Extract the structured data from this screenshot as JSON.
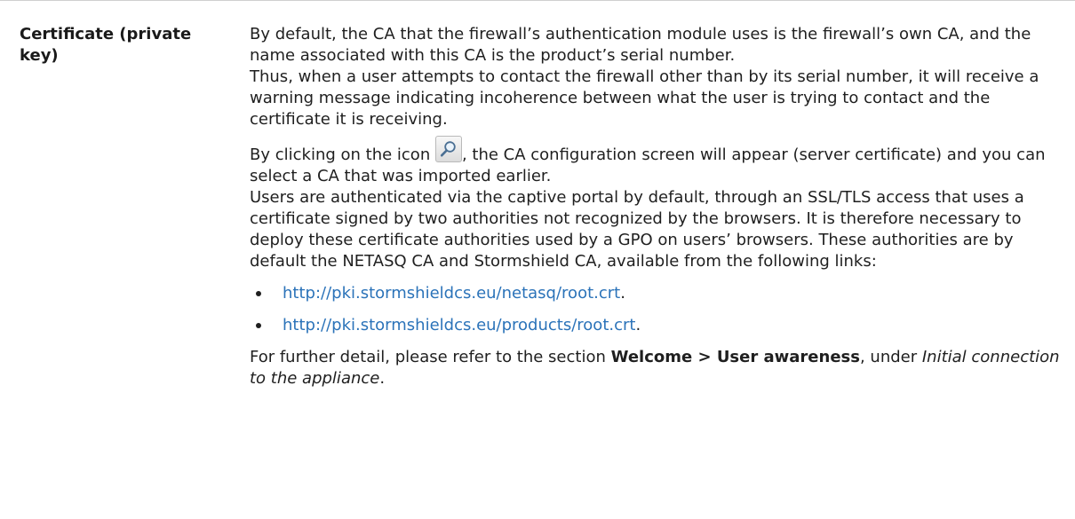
{
  "term": "Certificate (private key)",
  "paragraph1": "By default, the CA that the firewall’s authentication module uses is the firewall’s own CA, and the name associated with this CA is the product’s serial number.",
  "paragraph2": "Thus, when a user attempts to contact the firewall other than by its serial number, it will receive a warning message indicating incoherence between what the user is trying to contact and the certificate it is receiving.",
  "paragraph3_before_icon": "By clicking on the icon ",
  "icon": "magnifier-icon",
  "paragraph3_after_icon": ", the CA configuration screen will appear (server certificate) and you can select a CA that was imported earlier.",
  "paragraph4": "Users are authenticated via the captive portal by default, through an SSL/TLS access that uses a certificate signed by two authorities not recognized by the browsers. It is therefore necessary to deploy these certificate authorities used by a GPO on users’ browsers. These authorities are by default the NETASQ CA and Stormshield CA, available from the following links:",
  "links": [
    {
      "text": "http://pki.stormshieldcs.eu/netasq/root.crt",
      "suffix": "."
    },
    {
      "text": "http://pki.stormshieldcs.eu/products/root.crt",
      "suffix": "."
    }
  ],
  "footer": {
    "prefix": "For further detail, please refer to the section ",
    "section": "Welcome > User awareness",
    "middle": ", under ",
    "reference": "Initial connection to the appliance",
    "end": "."
  },
  "colors": {
    "link": "#2b73b9",
    "text": "#1f1f1f",
    "rule": "#cfcfcf"
  }
}
